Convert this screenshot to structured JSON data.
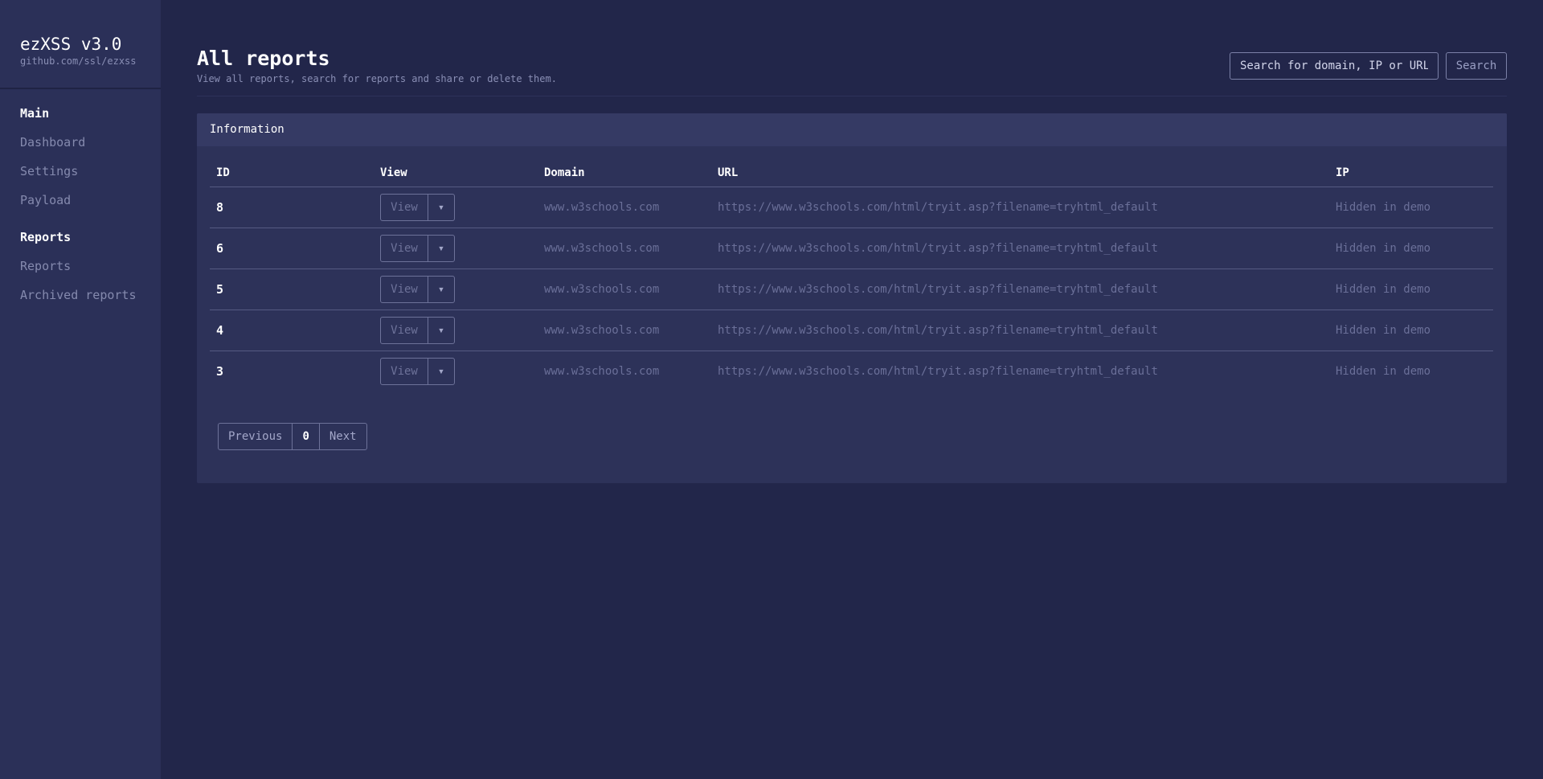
{
  "sidebar": {
    "brand_title": "ezXSS v3.0",
    "brand_subtitle": "github.com/ssl/ezxss",
    "sections": [
      {
        "label": "Main",
        "items": [
          {
            "label": "Dashboard"
          },
          {
            "label": "Settings"
          },
          {
            "label": "Payload"
          }
        ]
      },
      {
        "label": "Reports",
        "items": [
          {
            "label": "Reports"
          },
          {
            "label": "Archived reports"
          }
        ]
      }
    ]
  },
  "header": {
    "title": "All reports",
    "description": "View all reports, search for reports and share or delete them.",
    "search_placeholder": "Search for domain, IP or URL",
    "search_button": "Search"
  },
  "card": {
    "title": "Information",
    "columns": [
      "ID",
      "View",
      "Domain",
      "URL",
      "IP"
    ],
    "view_label": "View",
    "rows": [
      {
        "id": "8",
        "domain": "www.w3schools.com",
        "url": "https://www.w3schools.com/html/tryit.asp?filename=tryhtml_default",
        "ip": "Hidden in demo"
      },
      {
        "id": "6",
        "domain": "www.w3schools.com",
        "url": "https://www.w3schools.com/html/tryit.asp?filename=tryhtml_default",
        "ip": "Hidden in demo"
      },
      {
        "id": "5",
        "domain": "www.w3schools.com",
        "url": "https://www.w3schools.com/html/tryit.asp?filename=tryhtml_default",
        "ip": "Hidden in demo"
      },
      {
        "id": "4",
        "domain": "www.w3schools.com",
        "url": "https://www.w3schools.com/html/tryit.asp?filename=tryhtml_default",
        "ip": "Hidden in demo"
      },
      {
        "id": "3",
        "domain": "www.w3schools.com",
        "url": "https://www.w3schools.com/html/tryit.asp?filename=tryhtml_default",
        "ip": "Hidden in demo"
      }
    ]
  },
  "pagination": {
    "previous": "Previous",
    "current": "0",
    "next": "Next"
  },
  "colors": {
    "background": "#22264a",
    "sidebar": "#2b3058",
    "card": "#2d3259",
    "card_header": "#353a64",
    "muted_text": "#6a6f98"
  },
  "icons": {
    "dropdown": "caret-down-icon"
  }
}
